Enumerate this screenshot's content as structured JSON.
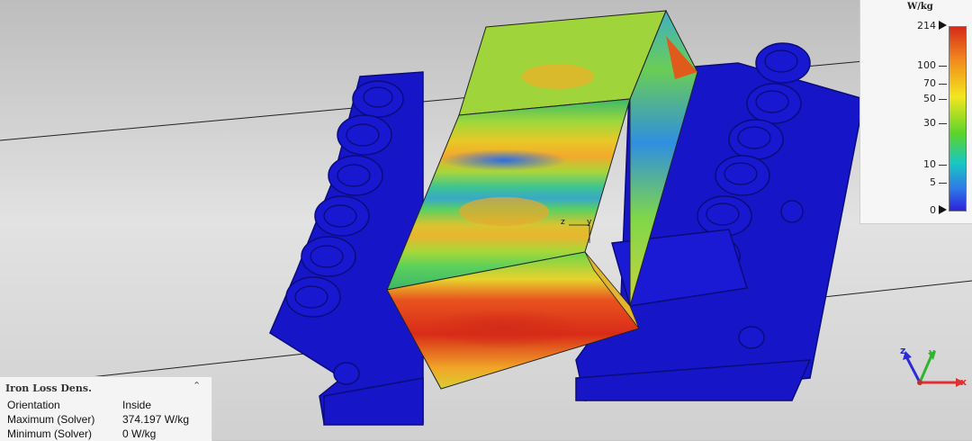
{
  "legend": {
    "unit": "W/kg",
    "max_label": "214",
    "ticks": [
      "100",
      "70",
      "50",
      "30",
      "10",
      "5",
      "0"
    ],
    "colors": [
      "#d62a1a",
      "#f28a1c",
      "#f3e61f",
      "#5cd42b",
      "#18c8c0",
      "#2f79ea",
      "#2b23d8"
    ]
  },
  "info": {
    "title": "Iron Loss Dens.",
    "rows": [
      {
        "label": "Orientation",
        "value": "Inside"
      },
      {
        "label": "Maximum (Solver)",
        "value": "374.197 W/kg"
      },
      {
        "label": "Minimum (Solver)",
        "value": "0 W/kg"
      }
    ]
  },
  "axes": {
    "x": "x",
    "y": "y",
    "z": "z"
  },
  "center_axes": {
    "z": "z",
    "y": "y"
  }
}
